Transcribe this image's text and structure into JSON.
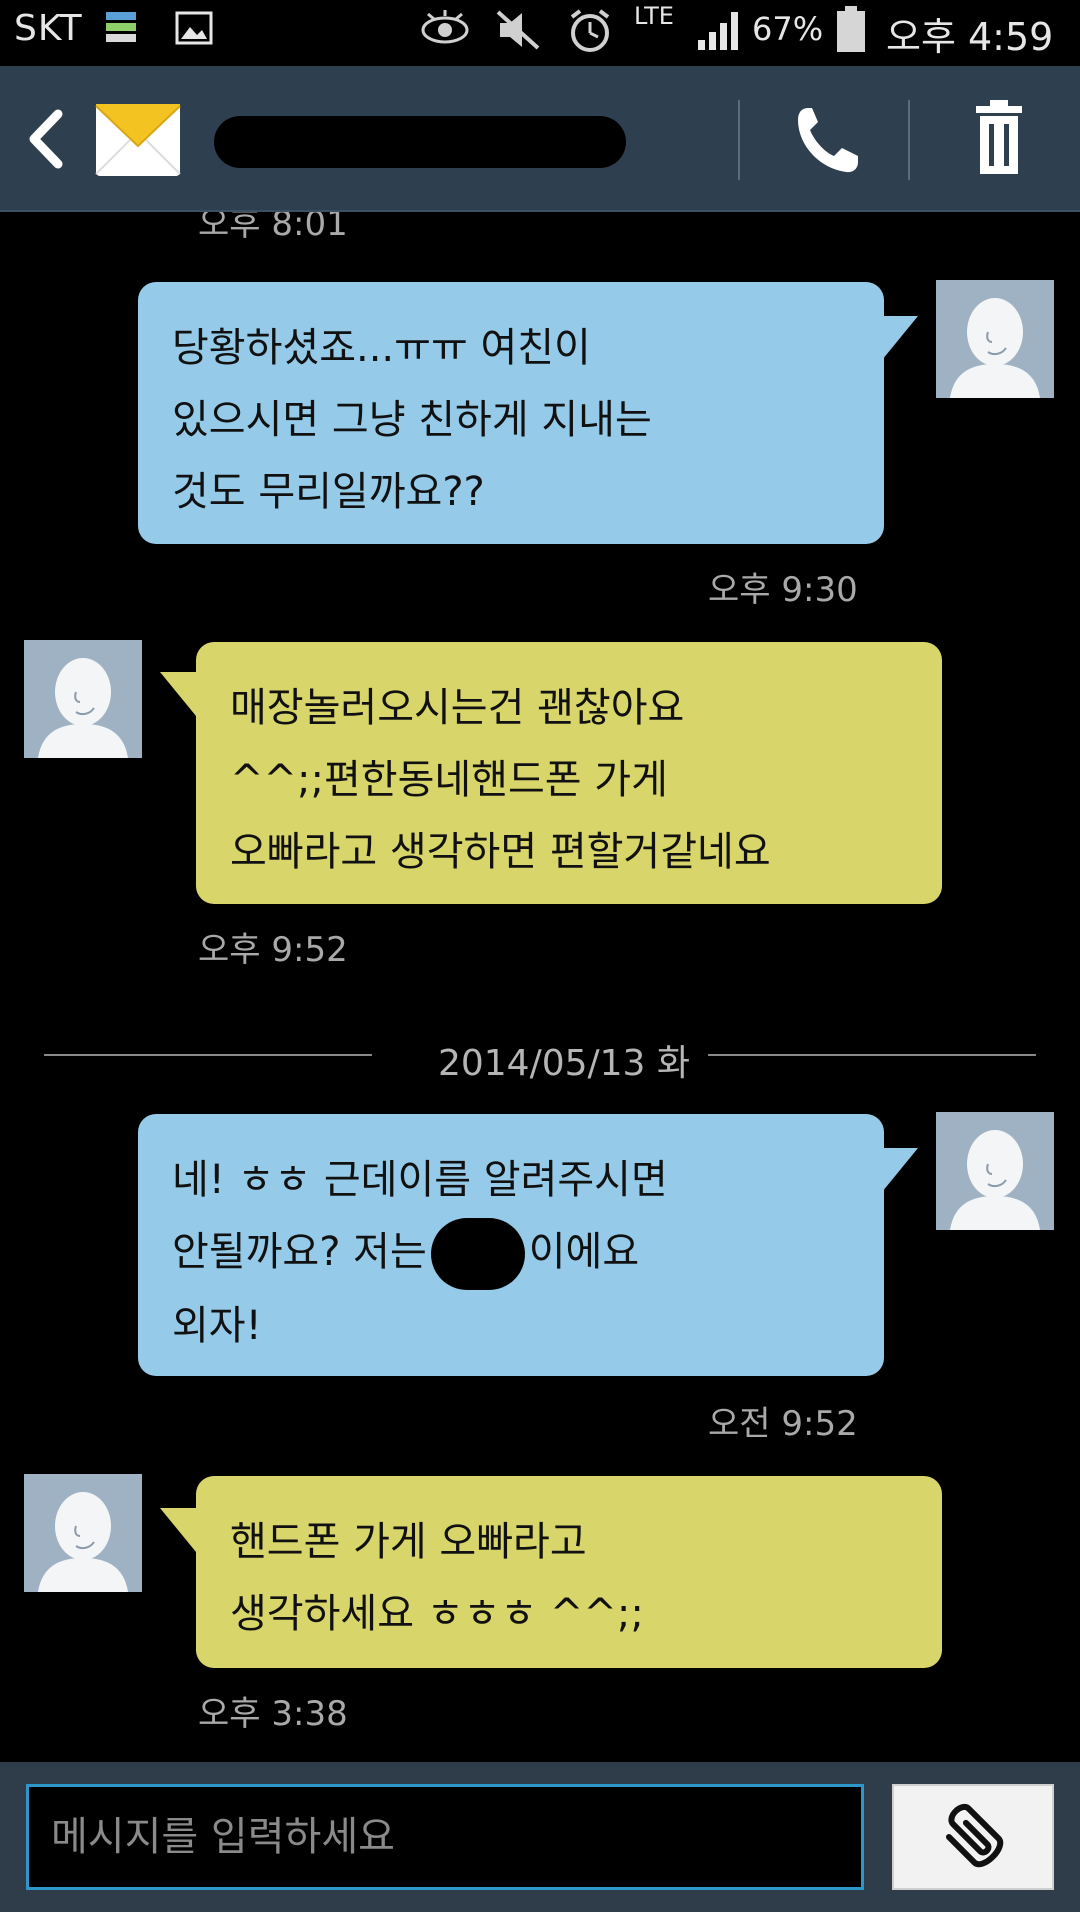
{
  "status_bar": {
    "carrier": "SKT",
    "network": "LTE",
    "battery": "67%",
    "time": "오후 4:59"
  },
  "header": {
    "back_icon": "chevron-left-icon",
    "envelope_icon": "envelope-icon",
    "call_icon": "phone-icon",
    "delete_icon": "trash-icon"
  },
  "messages": [
    {
      "type": "timestamp",
      "text": "오후 8:01"
    },
    {
      "type": "sent",
      "lines": [
        "당황하셨죠...ㅠㅠ 여친이",
        "있으시면 그냥 친하게 지내는",
        "것도 무리일까요??"
      ],
      "time": "오후 9:30"
    },
    {
      "type": "received",
      "lines": [
        "매장놀러오시는건 괜찮아요",
        "^^;;편한동네핸드폰 가게",
        "오빠라고 생각하면 편할거같네요"
      ],
      "time": "오후 9:52"
    },
    {
      "type": "date",
      "text": "2014/05/13 화"
    },
    {
      "type": "sent",
      "lines": [
        "네! ㅎㅎ 근데이름 알려주시면",
        "안될까요? 저는",
        "이에요",
        "외자!"
      ],
      "time": "오전 9:52"
    },
    {
      "type": "received",
      "lines": [
        "핸드폰 가게 오빠라고",
        "생각하세요 ㅎㅎㅎ ^^;;"
      ],
      "time": "오후 3:38"
    }
  ],
  "input": {
    "placeholder": "메시지를 입력하세요",
    "attach_icon": "paperclip-icon"
  },
  "colors": {
    "sent_bubble": "#95cae8",
    "received_bubble": "#d8d56a",
    "action_bar": "#2e3f4f",
    "input_border": "#2c97c9"
  }
}
